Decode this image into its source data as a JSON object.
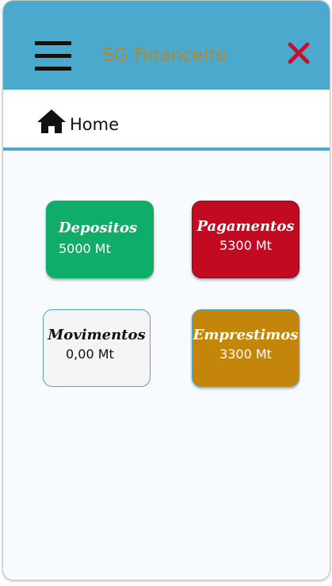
{
  "header": {
    "app_title": "SG Financeiro",
    "menu_icon": "hamburger-menu-icon",
    "close_icon": "close-x-icon",
    "background_color": "#4aa9cd",
    "title_color": "#b8862a",
    "close_color": "#c8102e"
  },
  "breadcrumb": {
    "icon": "home-icon",
    "label": "Home"
  },
  "cards": [
    {
      "label": "Depositos",
      "amount": "5000 Mt",
      "color": "#10ac69"
    },
    {
      "label": "Pagamentos",
      "amount": "5300 Mt",
      "color": "#c20b22"
    },
    {
      "label": "Movimentos",
      "amount": "0,00 Mt",
      "color": "#f4f4f4"
    },
    {
      "label": "Emprestimos",
      "amount": "3300 Mt",
      "color": "#c4850b"
    }
  ]
}
